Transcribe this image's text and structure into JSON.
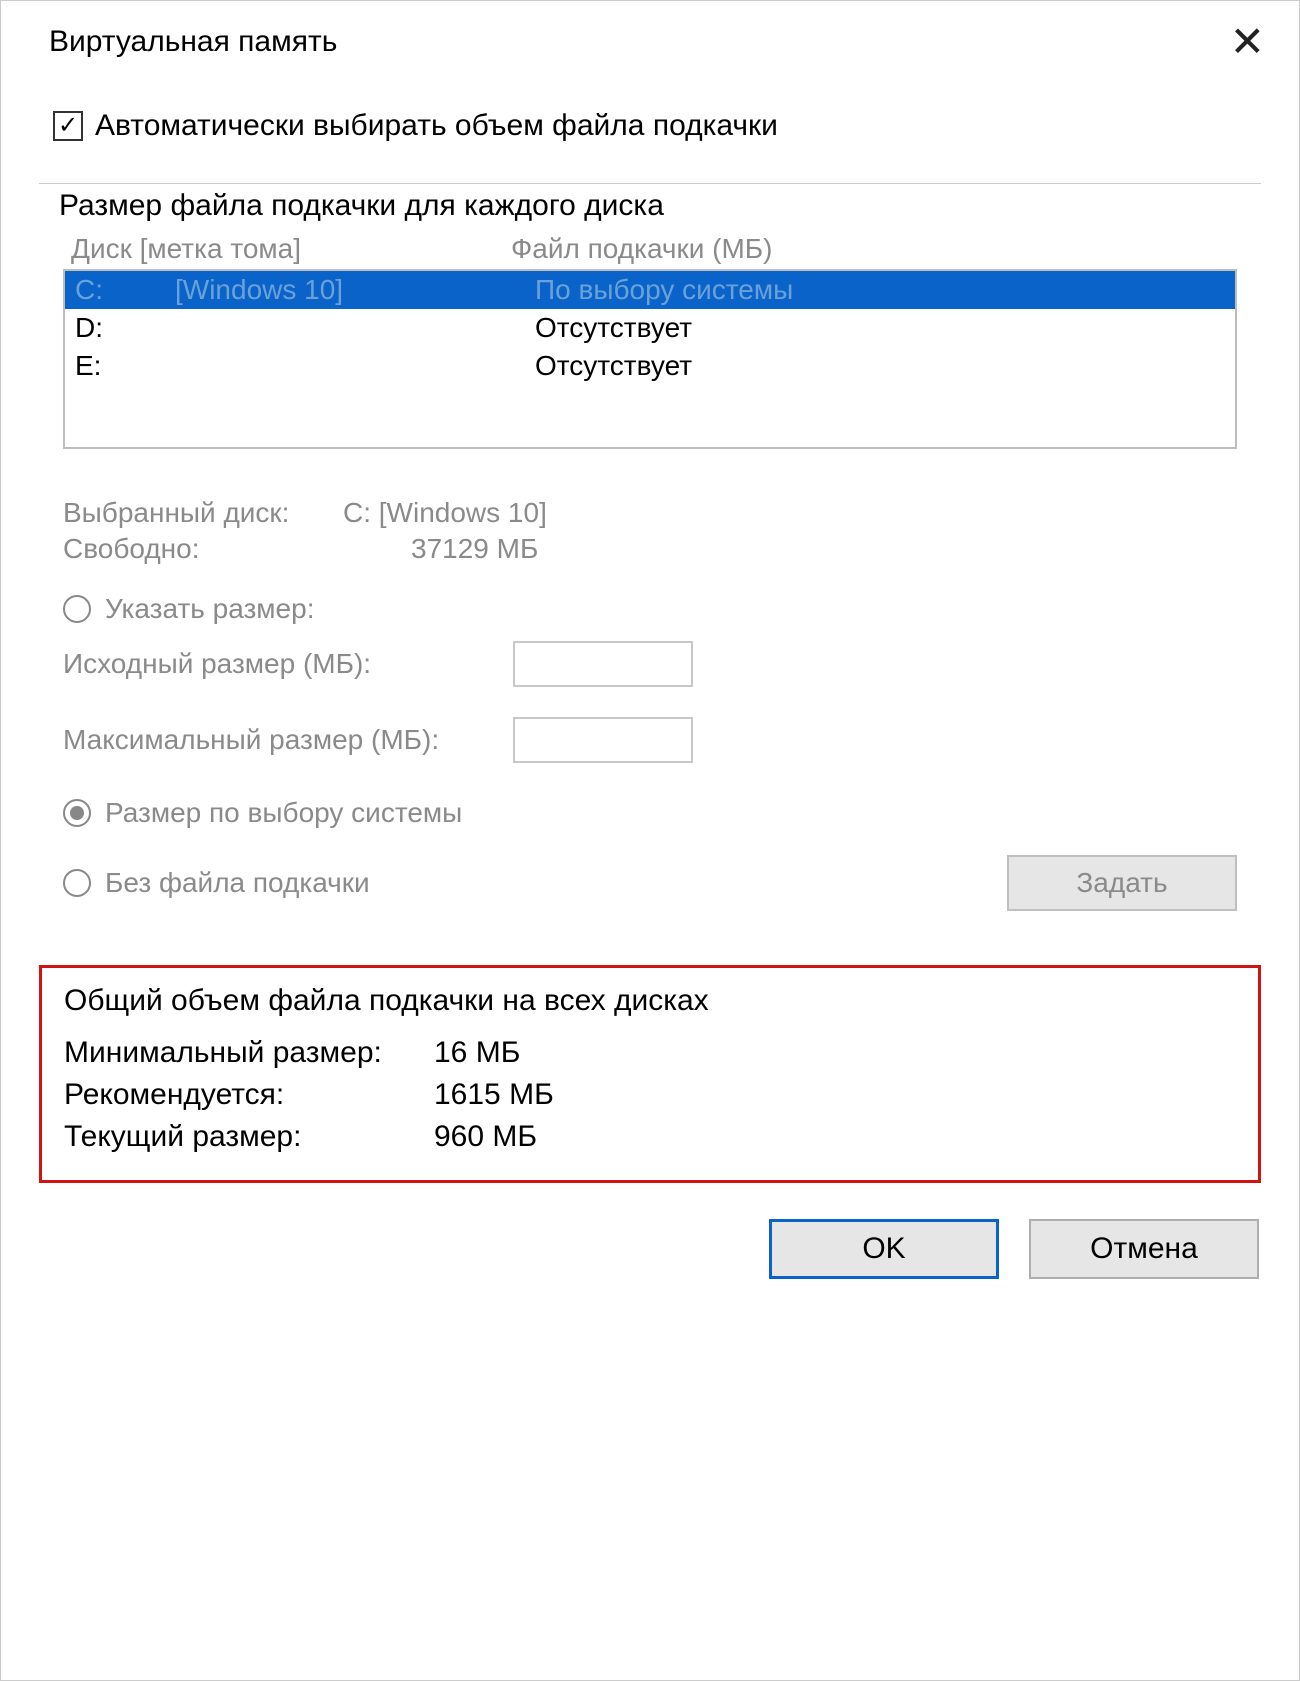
{
  "title": "Виртуальная память",
  "auto_checkbox": {
    "checked": true,
    "label": "Автоматически выбирать объем файла подкачки"
  },
  "group1": {
    "legend": "Размер файла подкачки для каждого диска",
    "header_drive": "Диск [метка тома]",
    "header_pf": "Файл подкачки (МБ)",
    "rows": [
      {
        "letter": "C:",
        "label": "[Windows 10]",
        "pf": "По выбору системы",
        "selected": true
      },
      {
        "letter": "D:",
        "label": "",
        "pf": "Отсутствует",
        "selected": false
      },
      {
        "letter": "E:",
        "label": "",
        "pf": "Отсутствует",
        "selected": false
      }
    ],
    "selected_disk_label": "Выбранный диск:",
    "selected_disk_value": "C: [Windows 10]",
    "free_label": "Свободно:",
    "free_value": "37129 МБ",
    "radio_custom": "Указать размер:",
    "initial_label": "Исходный размер (МБ):",
    "max_label": "Максимальный размер (МБ):",
    "radio_system": "Размер по выбору системы",
    "radio_none": "Без файла подкачки",
    "set_btn": "Задать"
  },
  "totals": {
    "legend": "Общий объем файла подкачки на всех дисках",
    "min_label": "Минимальный размер:",
    "min_value": "16 МБ",
    "rec_label": "Рекомендуется:",
    "rec_value": "1615 МБ",
    "cur_label": "Текущий размер:",
    "cur_value": "960 МБ"
  },
  "buttons": {
    "ok": "OK",
    "cancel": "Отмена"
  }
}
